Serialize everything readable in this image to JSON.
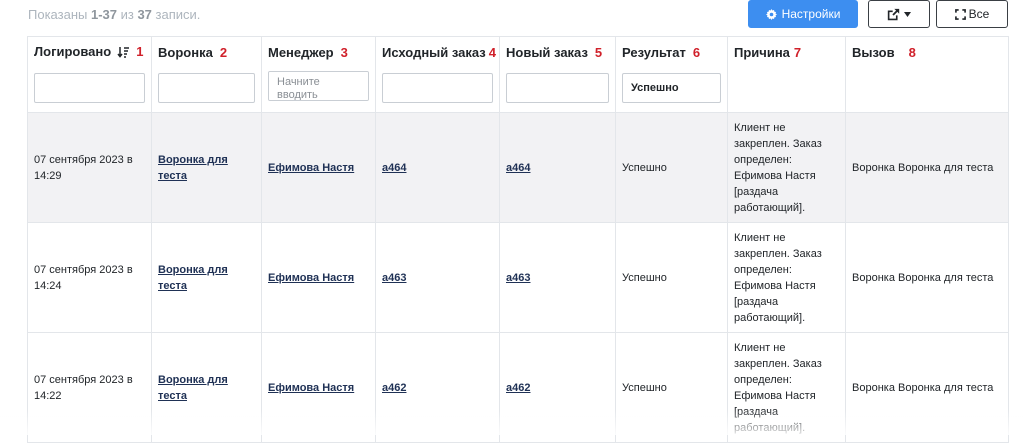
{
  "status": {
    "prefix": "Показаны ",
    "range": "1-37",
    "middle": " из ",
    "total": "37",
    "suffix": " записи."
  },
  "toolbar": {
    "settings_label": "Настройки",
    "settings_icon": "gear-icon",
    "export_icon": "external-link-icon",
    "all_label": "Все",
    "all_icon": "fullscreen-icon",
    "accent": "#3d8ef0"
  },
  "columns": [
    {
      "label": "Логировано",
      "num": "1"
    },
    {
      "label": "Воронка",
      "num": "2"
    },
    {
      "label": "Менеджер",
      "num": "3"
    },
    {
      "label": "Исходный заказ",
      "num": "4"
    },
    {
      "label": "Новый заказ",
      "num": "5"
    },
    {
      "label": "Результат",
      "num": "6"
    },
    {
      "label": "Причина",
      "num": "7"
    },
    {
      "label": "Вызов",
      "num": "8"
    }
  ],
  "filters": {
    "manager_placeholder": "Начните вводить",
    "result_value": "Успешно"
  },
  "rows": [
    {
      "logged": "07 сентября 2023 в 14:29",
      "funnel": "Воронка для теста",
      "manager": "Ефимова Настя",
      "source_order": "a464",
      "new_order": "a464",
      "result": "Успешно",
      "reason": "Клиент не закреплен. Заказ определен: Ефимова Настя [раздача работающий].",
      "call": "Воронка Воронка для теста"
    },
    {
      "logged": "07 сентября 2023 в 14:24",
      "funnel": "Воронка для теста",
      "manager": "Ефимова Настя",
      "source_order": "a463",
      "new_order": "a463",
      "result": "Успешно",
      "reason": "Клиент не закреплен. Заказ определен: Ефимова Настя [раздача работающий].",
      "call": "Воронка Воронка для теста"
    },
    {
      "logged": "07 сентября 2023 в 14:22",
      "funnel": "Воронка для теста",
      "manager": "Ефимова Настя",
      "source_order": "a462",
      "new_order": "a462",
      "result": "Успешно",
      "reason": "Клиент не закреплен. Заказ определен: Ефимова Настя [раздача работающий].",
      "call": "Воронка Воронка для теста"
    }
  ]
}
